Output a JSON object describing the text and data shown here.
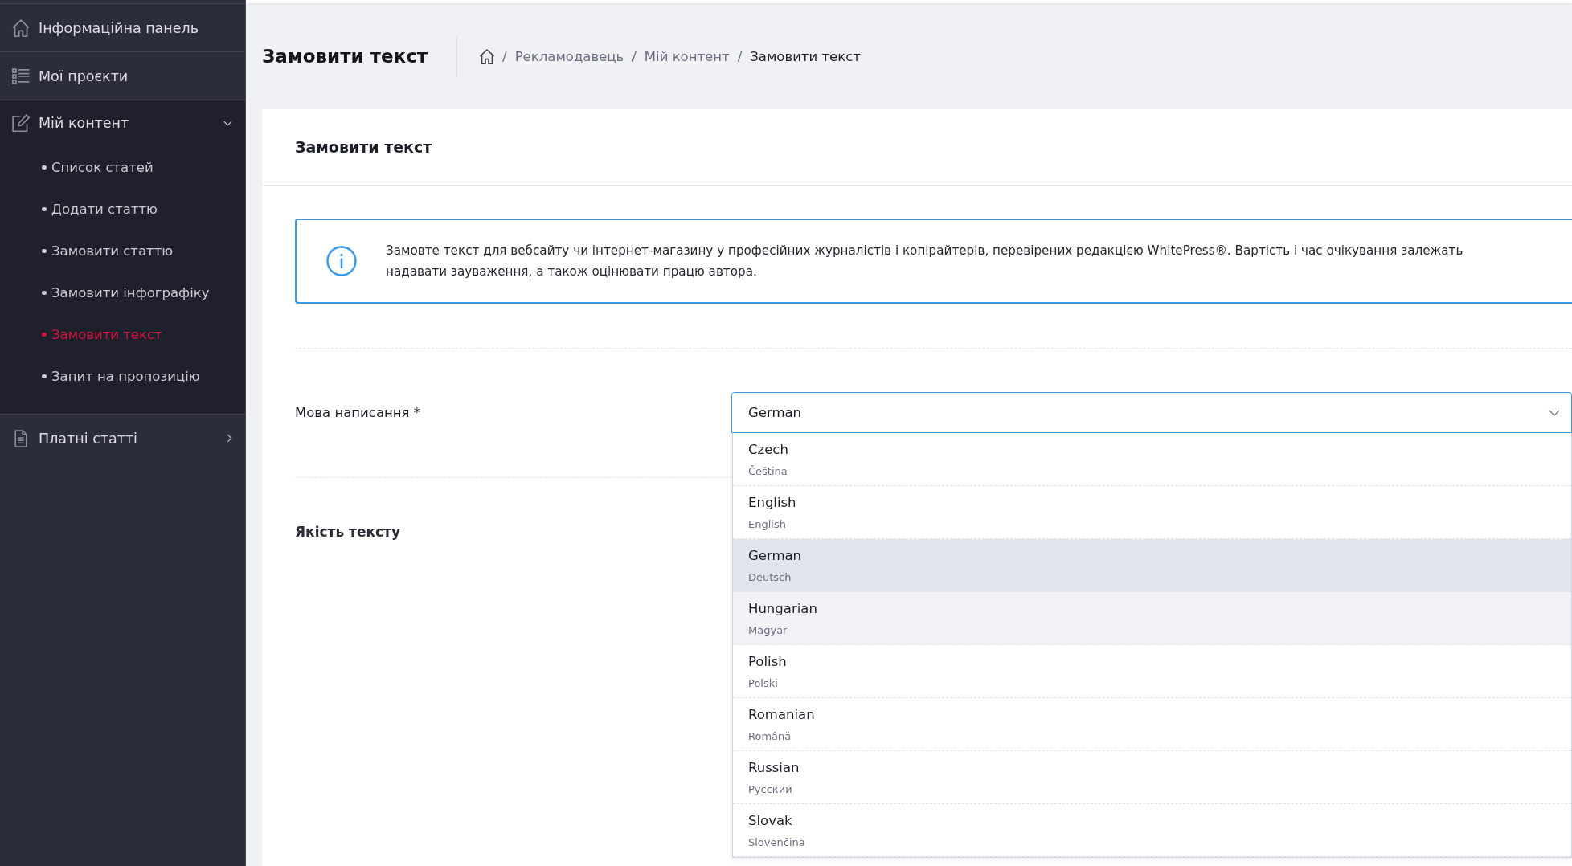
{
  "sidebar": {
    "items": [
      {
        "label": "Інформаційна панель",
        "kind": "link"
      },
      {
        "label": "Мої проєкти",
        "kind": "link"
      },
      {
        "label": "Мій контент",
        "kind": "group",
        "expanded": true,
        "children": [
          {
            "label": "Список статей",
            "selected": false
          },
          {
            "label": "Додати статтю",
            "selected": false
          },
          {
            "label": "Замовити статтю",
            "selected": false
          },
          {
            "label": "Замовити інфографіку",
            "selected": false
          },
          {
            "label": "Замовити текст",
            "selected": true
          },
          {
            "label": "Запит на пропозицію",
            "selected": false
          }
        ]
      },
      {
        "label": "Платні статті",
        "kind": "group",
        "expanded": false
      }
    ]
  },
  "page_header": {
    "title": "Замовити текст",
    "breadcrumb": [
      {
        "kind": "home"
      },
      {
        "kind": "separator",
        "text": "/"
      },
      {
        "kind": "link",
        "text": "Рекламодавець"
      },
      {
        "kind": "separator",
        "text": "/"
      },
      {
        "kind": "link",
        "text": "Мій контент"
      },
      {
        "kind": "separator",
        "text": "/"
      },
      {
        "kind": "current",
        "text": "Замовити текст"
      }
    ]
  },
  "card": {
    "title": "Замовити текст",
    "info": {
      "lines": [
        "Замовте текст для вебсайту чи інтернет-магазину у професійних журналістів і копірайтерів, перевірених редакцією WhitePress®. Вартість і час очікування залежать",
        "надавати зауваження, а також оцінювати працю автора."
      ]
    },
    "rows": [
      {
        "kind": "select",
        "label": "Мова написання *",
        "value": "German",
        "open": true,
        "options": [
          {
            "name": "Czech",
            "native": "Čeština",
            "selected": false,
            "highlighted": false
          },
          {
            "name": "English",
            "native": "English",
            "selected": false,
            "highlighted": false
          },
          {
            "name": "German",
            "native": "Deutsch",
            "selected": true,
            "highlighted": false
          },
          {
            "name": "Hungarian",
            "native": "Magyar",
            "selected": false,
            "highlighted": true
          },
          {
            "name": "Polish",
            "native": "Polski",
            "selected": false,
            "highlighted": false
          },
          {
            "name": "Romanian",
            "native": "Română",
            "selected": false,
            "highlighted": false
          },
          {
            "name": "Russian",
            "native": "Русский",
            "selected": false,
            "highlighted": false
          },
          {
            "name": "Slovak",
            "native": "Slovenčina",
            "selected": false,
            "highlighted": false
          }
        ]
      },
      {
        "kind": "section",
        "label": "Якість тексту"
      }
    ]
  }
}
